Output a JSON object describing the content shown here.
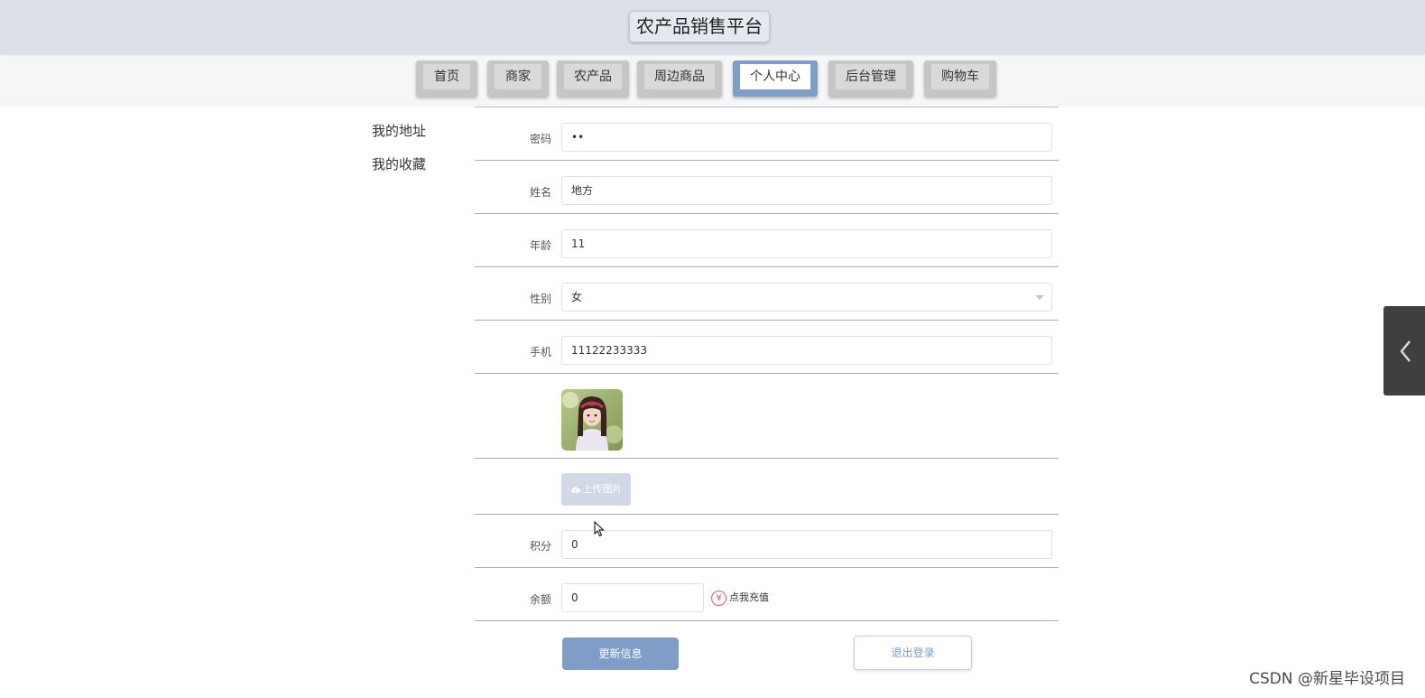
{
  "header": {
    "title": "农产品销售平台"
  },
  "nav": {
    "items": [
      {
        "label": "首页",
        "active": false
      },
      {
        "label": "商家",
        "active": false
      },
      {
        "label": "农产品",
        "active": false
      },
      {
        "label": "周边商品",
        "active": false
      },
      {
        "label": "个人中心",
        "active": true
      },
      {
        "label": "后台管理",
        "active": false
      },
      {
        "label": "购物车",
        "active": false
      }
    ]
  },
  "sidebar": {
    "items": [
      {
        "label": "我的地址"
      },
      {
        "label": "我的收藏"
      }
    ]
  },
  "form": {
    "password": {
      "label": "密码",
      "value": "••"
    },
    "name": {
      "label": "姓名",
      "value": "地方"
    },
    "age": {
      "label": "年龄",
      "value": "11"
    },
    "gender": {
      "label": "性别",
      "value": "女"
    },
    "phone": {
      "label": "手机",
      "value": "11122233333"
    },
    "upload_label": "上传图片",
    "points": {
      "label": "积分",
      "value": "0"
    },
    "balance": {
      "label": "余额",
      "value": "0"
    },
    "recharge_label": "点我充值",
    "recharge_icon": "¥"
  },
  "actions": {
    "update_label": "更新信息",
    "logout_label": "退出登录"
  },
  "watermark": "CSDN @新星毕设项目",
  "colors": {
    "accent": "#7e9ec8",
    "header_bg": "#dbe0e9",
    "recharge_icon": "#e45a6a"
  }
}
